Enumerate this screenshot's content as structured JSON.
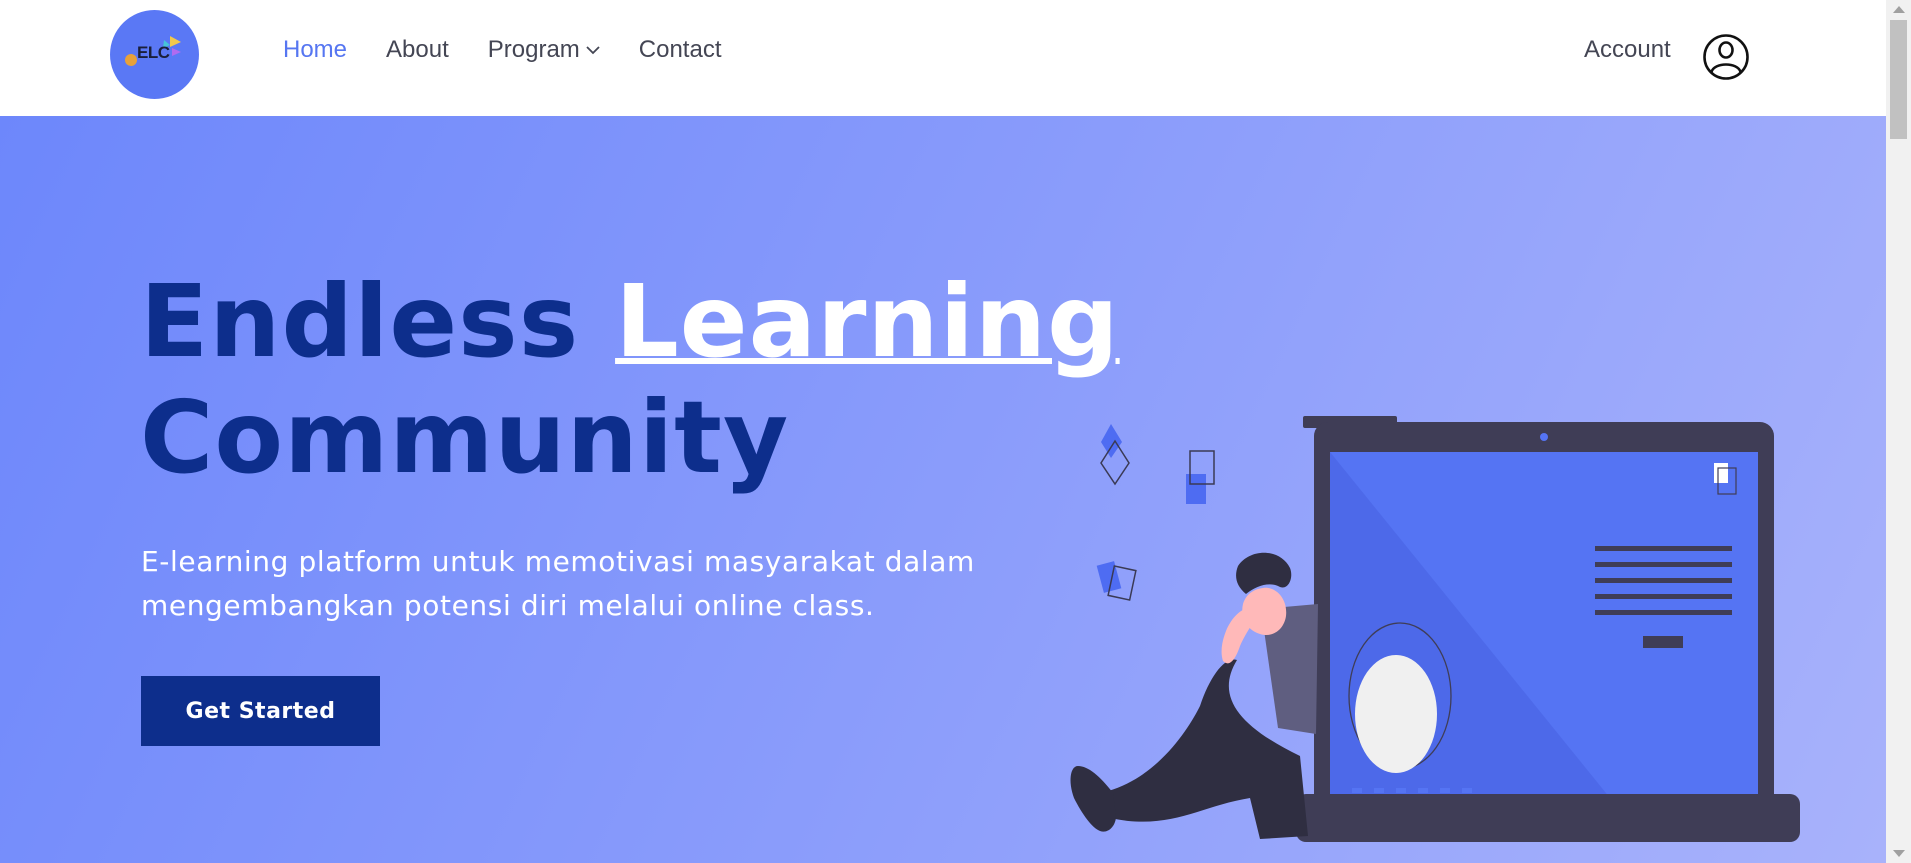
{
  "brand": {
    "logo_text": "ELC",
    "logo_color": "#5a78f5"
  },
  "nav": {
    "items": [
      {
        "label": "Home",
        "active": true
      },
      {
        "label": "About",
        "active": false
      },
      {
        "label": "Program",
        "active": false,
        "has_dropdown": true
      },
      {
        "label": "Contact",
        "active": false
      }
    ],
    "account_label": "Account"
  },
  "hero": {
    "title_line1_a": "Endless",
    "title_line1_b": "Learning",
    "title_line2": "Community",
    "description": "E-learning platform untuk memotivasi masyarakat dalam mengembangkan potensi diri melalui online class.",
    "cta_label": "Get Started"
  },
  "colors": {
    "accent": "#5676f1",
    "title": "#0d2e8c",
    "button": "#0d2e8c",
    "hero_gradient_start": "#6d87fb",
    "hero_gradient_end": "#a8b2fb"
  },
  "icons": {
    "account": "user-circle-icon",
    "program_dropdown": "chevron-down-icon"
  }
}
